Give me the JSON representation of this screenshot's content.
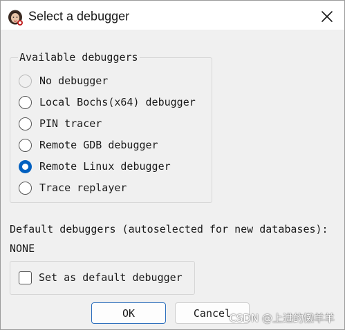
{
  "window": {
    "title": "Select a debugger",
    "app_icon": "ida-icon",
    "close_icon": "close-icon"
  },
  "debuggers_group": {
    "label": "Available debuggers",
    "options": [
      {
        "label": "No debugger",
        "selected": false,
        "disabled": true
      },
      {
        "label": "Local Bochs(x64) debugger",
        "selected": false,
        "disabled": false
      },
      {
        "label": "PIN tracer",
        "selected": false,
        "disabled": false
      },
      {
        "label": "Remote GDB debugger",
        "selected": false,
        "disabled": false
      },
      {
        "label": "Remote Linux debugger",
        "selected": true,
        "disabled": false
      },
      {
        "label": "Trace replayer",
        "selected": false,
        "disabled": false
      }
    ]
  },
  "defaults": {
    "label": "Default debuggers (autoselected for new databases):",
    "value": "NONE"
  },
  "set_default_checkbox": {
    "label": "Set as default debugger",
    "checked": false
  },
  "buttons": {
    "ok": "OK",
    "cancel": "Cancel"
  },
  "watermark": "CSDN @上进的懒羊羊",
  "colors": {
    "accent": "#0060c0",
    "window_bg": "#f0f0f0",
    "primary_border": "#2d6fbd"
  }
}
